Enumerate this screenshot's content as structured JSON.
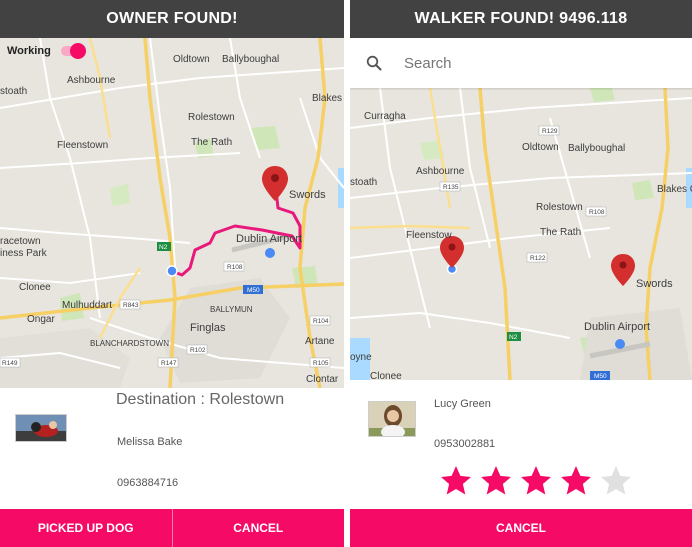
{
  "left_screen": {
    "title": "OWNER FOUND!",
    "toggle_label": "Working",
    "map_labels": {
      "ashbourne": "Ashbourne",
      "oldtown": "Oldtown",
      "ballyboughal": "Ballyboughal",
      "stoath": "stoath",
      "blakes": "Blakes",
      "rolestown": "Rolestown",
      "fleenstown": "Fleenstown",
      "therath": "The Rath",
      "swords": "Swords",
      "racetown": "racetown",
      "iness_park": "iness Park",
      "dublin_airport": "Dublin Airport",
      "clonee": "Clonee",
      "mulhuddart": "Mulhuddart",
      "ongar": "Ongar",
      "ballymun": "BALLYMUN",
      "finglas": "Finglas",
      "blanchardstown": "BLANCHARDSTOWN",
      "artane": "Artane",
      "clontarf": "Clontar",
      "r108": "R108",
      "r843": "R843",
      "r102": "R102",
      "r104": "R104",
      "r105": "R105",
      "r147": "R147",
      "r149": "R149",
      "m50": "M50",
      "n2": "N2"
    },
    "destination": "Destination : Rolestown",
    "person_name": "Melissa Bake",
    "phone": "0963884716",
    "buttons": {
      "picked_up": "PICKED UP DOG",
      "cancel": "CANCEL"
    }
  },
  "right_screen": {
    "title": "WALKER FOUND! 9496.118",
    "search_placeholder": "Search",
    "map_labels": {
      "curragha": "Curragha",
      "r129": "R129",
      "oldtown": "Oldtown",
      "ballyboughal": "Ballyboughal",
      "ashbourne": "Ashbourne",
      "r135": "R135",
      "stoath": "stoath",
      "blakes": "Blakes C",
      "rolestown": "Rolestown",
      "r108": "R108",
      "fleenstown": "Fleenstow",
      "therath": "The Rath",
      "r122": "R122",
      "swords": "Swords",
      "dublin_airport": "Dublin Airport",
      "oyne": "oyne",
      "clonee": "Clonee",
      "n2": "N2",
      "m50": "M50"
    },
    "person_name": "Lucy Green",
    "phone": "0953002881",
    "rating": 4,
    "rating_max": 5,
    "buttons": {
      "cancel": "CANCEL"
    }
  },
  "colors": {
    "accent": "#f50a66",
    "topbar": "#424242",
    "route": "#e8197a",
    "pin": "#d32f2f",
    "star_filled": "#f50a66",
    "star_empty": "#e0e0e0"
  }
}
